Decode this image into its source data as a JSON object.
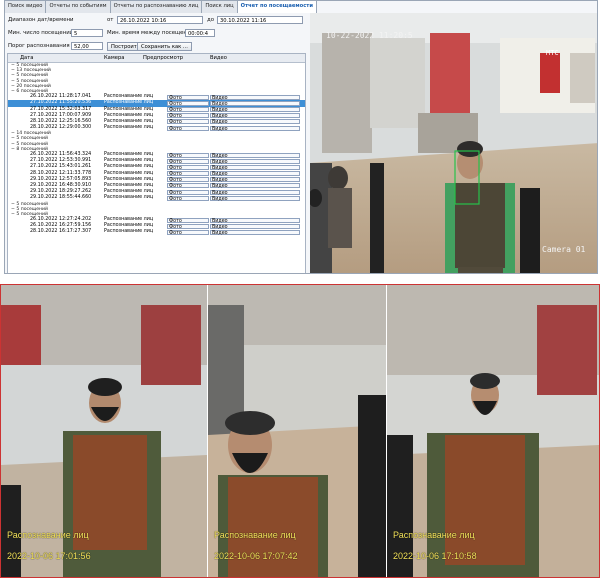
{
  "tabs": [
    "Поиск видео",
    "Отчеты по событиям",
    "Отчеты по распознаванию лиц",
    "Поиск лиц",
    "Отчет по посещаемости"
  ],
  "active_tab": 4,
  "filters": {
    "range_label": "Диапазон дат/времени",
    "from_label": "от",
    "from_value": "26.10.2022 10:16",
    "to_label": "до",
    "to_value": "30.10.2022 11:16",
    "min_visits_label": "Мин. число посещений",
    "min_visits_value": "5",
    "min_interval_label": "Мин. время между посещениями",
    "min_interval_value": "00:00:4",
    "threshold_label": "Порог распознавания",
    "threshold_value": "52,00",
    "build_button": "Построить",
    "save_button": "Сохранить как ..."
  },
  "grid": {
    "columns": [
      "Дата",
      "Камера",
      "Предпросмотр",
      "Видео"
    ],
    "groups_top": [
      "5 посещений",
      "13 посещений",
      "5 посещений",
      "5 посещений",
      "20 посещений"
    ],
    "group_a": "6 посещений",
    "rows_a": [
      {
        "date": "26.10.2022 11:28:17.041",
        "camera": "Распознавание лиц",
        "preview": "Фото",
        "video": "Видео"
      },
      {
        "date": "27.10.2022 11:55:20.536",
        "camera": "Распознавание лиц",
        "preview": "Фото",
        "video": "Видео"
      },
      {
        "date": "27.10.2022 15:32:03.317",
        "camera": "Распознавание лиц",
        "preview": "Фото",
        "video": "Видео"
      },
      {
        "date": "27.10.2022 17:00:07.909",
        "camera": "Распознавание лиц",
        "preview": "Фото",
        "video": "Видео"
      },
      {
        "date": "28.10.2022 12:25:16.560",
        "camera": "Распознавание лиц",
        "preview": "Фото",
        "video": "Видео"
      },
      {
        "date": "28.10.2022 12:29:00.300",
        "camera": "Распознавание лиц",
        "preview": "Фото",
        "video": "Видео"
      }
    ],
    "groups_mid": [
      "14 посещений",
      "5 посещений",
      "5 посещений"
    ],
    "group_b": "8 посещений",
    "rows_b": [
      {
        "date": "26.10.2022 11:56:43.324",
        "camera": "Распознавание лиц",
        "preview": "Фото",
        "video": "Видео"
      },
      {
        "date": "27.10.2022 12:53:30.991",
        "camera": "Распознавание лиц",
        "preview": "Фото",
        "video": "Видео"
      },
      {
        "date": "27.10.2022 15:43:01.261",
        "camera": "Распознавание лиц",
        "preview": "Фото",
        "video": "Видео"
      },
      {
        "date": "28.10.2022 12:11:33.778",
        "camera": "Распознавание лиц",
        "preview": "Фото",
        "video": "Видео"
      },
      {
        "date": "29.10.2022 12:57:05.893",
        "camera": "Распознавание лиц",
        "preview": "Фото",
        "video": "Видео"
      },
      {
        "date": "29.10.2022 16:48:30.910",
        "camera": "Распознавание лиц",
        "preview": "Фото",
        "video": "Видео"
      },
      {
        "date": "29.10.2022 18:29:27.262",
        "camera": "Распознавание лиц",
        "preview": "Фото",
        "video": "Видео"
      },
      {
        "date": "29.10.2022 18:55:44.660",
        "camera": "Распознавание лиц",
        "preview": "Фото",
        "video": "Видео"
      }
    ],
    "groups_bot": [
      "5 посещений",
      "5 посещений"
    ],
    "group_c": "5 посещений",
    "rows_c": [
      {
        "date": "26.10.2022 12:27:24.202",
        "camera": "Распознавание лиц",
        "preview": "Фото",
        "video": "Видео"
      },
      {
        "date": "26.10.2022 16:27:59.156",
        "camera": "Распознавание лиц",
        "preview": "Фото",
        "video": "Видео"
      },
      {
        "date": "28.10.2022 16:17:27.307",
        "camera": "Распознавание лиц",
        "preview": "Фото",
        "video": "Видео"
      }
    ]
  },
  "camera_main": {
    "timestamp": "10-22-2022 11:20:5",
    "label": "Camera 01",
    "store_sign": "МТС"
  },
  "snapshots": [
    {
      "caption": "Распознавание лиц",
      "time": "2022-10-06 17:01:56"
    },
    {
      "caption": "Распознавание лиц",
      "time": "2022-10-06 17:07:42"
    },
    {
      "caption": "Распознавание лиц",
      "time": "2022-10-06 17:10:58"
    }
  ],
  "colors": {
    "selection": "#3d8fd6",
    "border_red": "#cc3333",
    "caption_yellow": "#f3e25a"
  }
}
